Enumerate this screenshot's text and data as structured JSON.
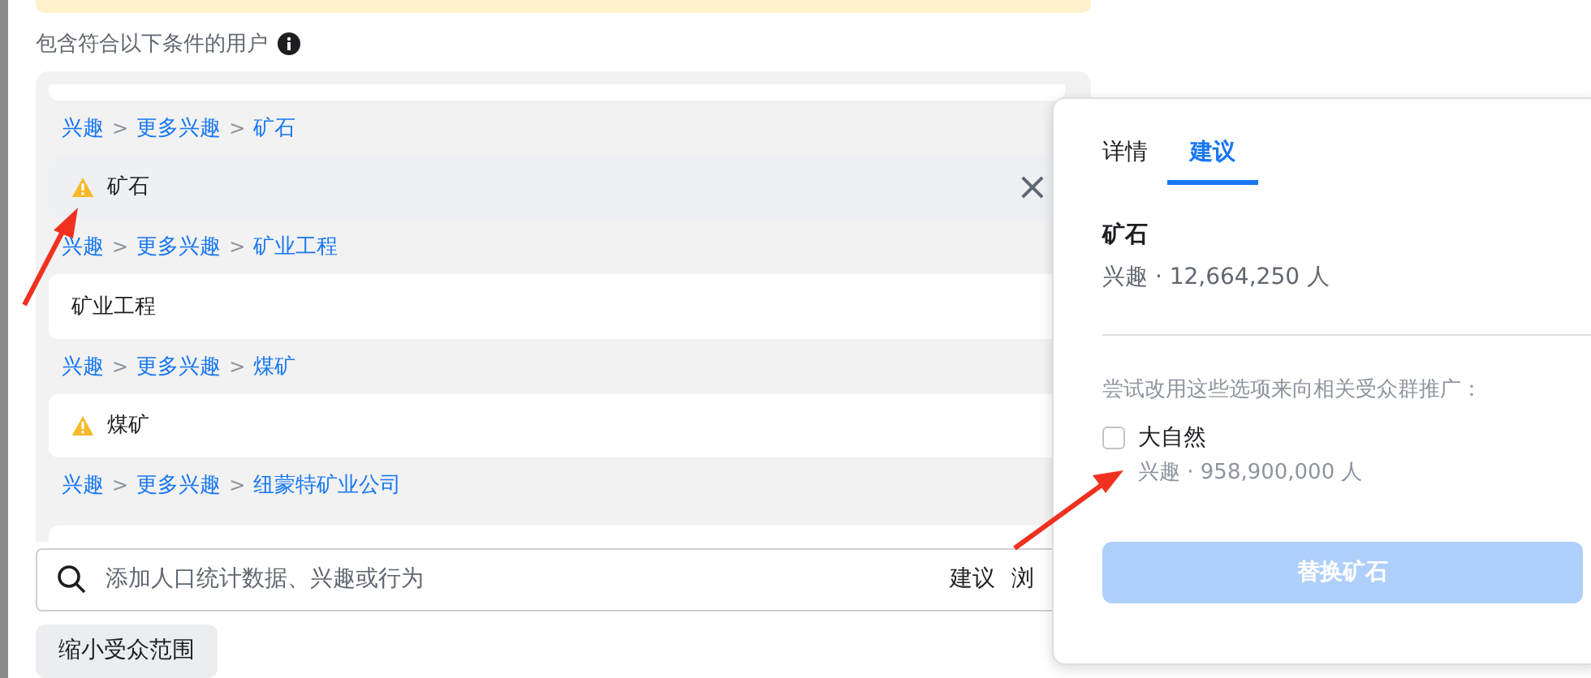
{
  "heading": {
    "text": "包含符合以下条件的用户"
  },
  "criteria": [
    {
      "path": [
        "兴趣",
        "更多兴趣",
        "矿石"
      ],
      "separator": ">",
      "item": {
        "label": "矿石",
        "warning": true,
        "selected": true,
        "remove": "×"
      }
    },
    {
      "path": [
        "兴趣",
        "更多兴趣",
        "矿业工程"
      ],
      "separator": ">",
      "item": {
        "label": "矿业工程",
        "warning": false,
        "selected": false
      }
    },
    {
      "path": [
        "兴趣",
        "更多兴趣",
        "煤矿"
      ],
      "separator": ">",
      "item": {
        "label": "煤矿",
        "warning": true,
        "selected": false
      }
    },
    {
      "path": [
        "兴趣",
        "更多兴趣",
        "纽蒙特矿业公司"
      ],
      "separator": ">"
    }
  ],
  "search": {
    "placeholder": "添加人口统计数据、兴趣或行为",
    "links": [
      "建议",
      "浏"
    ]
  },
  "narrow_button": "缩小受众范围",
  "popover": {
    "tabs": [
      {
        "label": "详情",
        "selected": false
      },
      {
        "label": "建议",
        "selected": true
      }
    ],
    "title": "矿石",
    "subtitle": "兴趣 · 12,664,250 人",
    "hint": "尝试改用这些选项来向相关受众群推广：",
    "options": [
      {
        "label": "大自然",
        "detail": "兴趣 · 958,900,000 人",
        "checked": false
      }
    ],
    "button": {
      "label": "替换矿石",
      "disabled": true
    }
  }
}
